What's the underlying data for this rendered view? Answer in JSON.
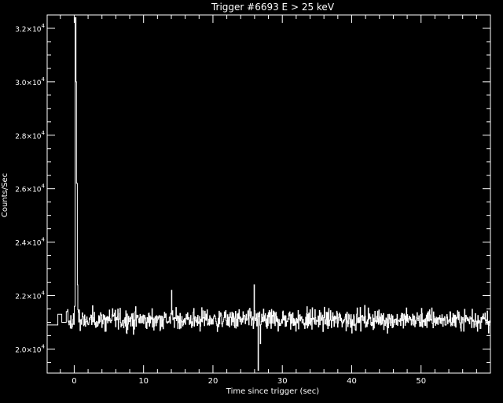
{
  "chart_data": {
    "type": "line",
    "title": "Trigger #6693 E > 25 keV",
    "xlabel": "Time since trigger (sec)",
    "ylabel": "Counts/Sec",
    "xlim": [
      -3.9,
      60
    ],
    "ylim": [
      19100,
      32500
    ],
    "x_ticks": [
      0,
      10,
      20,
      30,
      40,
      50
    ],
    "x_tick_labels": [
      "0",
      "10",
      "20",
      "30",
      "40",
      "50"
    ],
    "y_ticks": [
      20000,
      22000,
      24000,
      26000,
      28000,
      30000,
      32000
    ],
    "y_tick_labels": [
      {
        "mant": "2.0",
        "exp": "4"
      },
      {
        "mant": "2.2",
        "exp": "4"
      },
      {
        "mant": "2.4",
        "exp": "4"
      },
      {
        "mant": "2.6",
        "exp": "4"
      },
      {
        "mant": "2.8",
        "exp": "4"
      },
      {
        "mant": "3.0",
        "exp": "4"
      },
      {
        "mant": "3.2",
        "exp": "4"
      }
    ],
    "line_color": "#ffffff",
    "background": "#000000",
    "grid": false,
    "bin_width_sec": 0.064,
    "noise_baseline": 21100,
    "series": [
      {
        "values_note_points": [
          [
            -3.9,
            20900
          ],
          [
            -3.0,
            20900
          ],
          [
            -2.4,
            21300
          ],
          [
            -1.8,
            21000
          ],
          [
            -1.2,
            21400
          ],
          [
            -0.6,
            21200
          ],
          [
            -0.2,
            21500
          ],
          [
            0.0,
            21600
          ],
          [
            0.12,
            32400
          ],
          [
            0.2,
            30000
          ],
          [
            0.28,
            26200
          ],
          [
            0.36,
            26200
          ],
          [
            0.45,
            22400
          ],
          [
            0.6,
            21600
          ],
          [
            1.5,
            21300
          ],
          [
            2.5,
            21200
          ],
          [
            3.5,
            21400
          ],
          [
            5.0,
            20900
          ],
          [
            7.0,
            21500
          ],
          [
            10.0,
            21100
          ],
          [
            12.0,
            21800
          ],
          [
            13.5,
            21100
          ],
          [
            14.0,
            22200
          ],
          [
            14.3,
            20800
          ],
          [
            16.0,
            21600
          ],
          [
            18.0,
            20800
          ],
          [
            20.0,
            21200
          ],
          [
            23.0,
            21400
          ],
          [
            25.0,
            20900
          ],
          [
            25.9,
            22400
          ],
          [
            26.2,
            21000
          ],
          [
            26.5,
            19200
          ],
          [
            26.8,
            20200
          ],
          [
            27.2,
            21400
          ],
          [
            30.0,
            21200
          ],
          [
            33.0,
            21000
          ],
          [
            36.0,
            21300
          ],
          [
            40.0,
            21100
          ],
          [
            43.5,
            21900
          ],
          [
            44.0,
            20700
          ],
          [
            47.0,
            21400
          ],
          [
            50.0,
            21000
          ],
          [
            53.0,
            21300
          ],
          [
            56.0,
            21200
          ],
          [
            60.0,
            21000
          ]
        ]
      }
    ]
  }
}
